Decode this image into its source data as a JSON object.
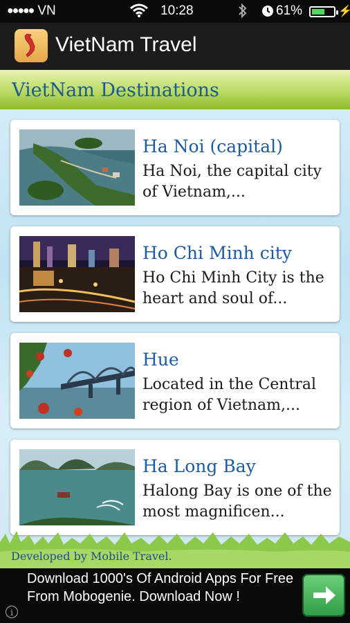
{
  "status_bar": {
    "signal_dots": "●●●●●",
    "carrier": "VN",
    "time": "10:28",
    "battery_percent": "61%",
    "battery_level": 0.61
  },
  "app_bar": {
    "title": "VietNam Travel",
    "icon": "vietnam-map-icon"
  },
  "section": {
    "title": "VietNam Destinations"
  },
  "destinations": [
    {
      "title": "Ha Noi (capital)",
      "description": "Ha Noi, the capital city of Vietnam,..."
    },
    {
      "title": "Ho Chi Minh city",
      "description": "Ho Chi Minh City is the heart and soul of..."
    },
    {
      "title": "Hue",
      "description": "Located in the Central region of Vietnam,..."
    },
    {
      "title": "Ha Long Bay",
      "description": "Halong Bay is one of the most magnificen..."
    }
  ],
  "footer": {
    "credit": "Developed by Mobile Travel."
  },
  "ad": {
    "text": "Download 1000's Of Android Apps For Free From Mobogenie. Download Now !",
    "info_glyph": "i",
    "button_icon": "arrow-right-icon"
  },
  "colors": {
    "title_blue": "#1e5aa0",
    "header_green": "#8fba2e",
    "battery_green": "#4cd964"
  }
}
